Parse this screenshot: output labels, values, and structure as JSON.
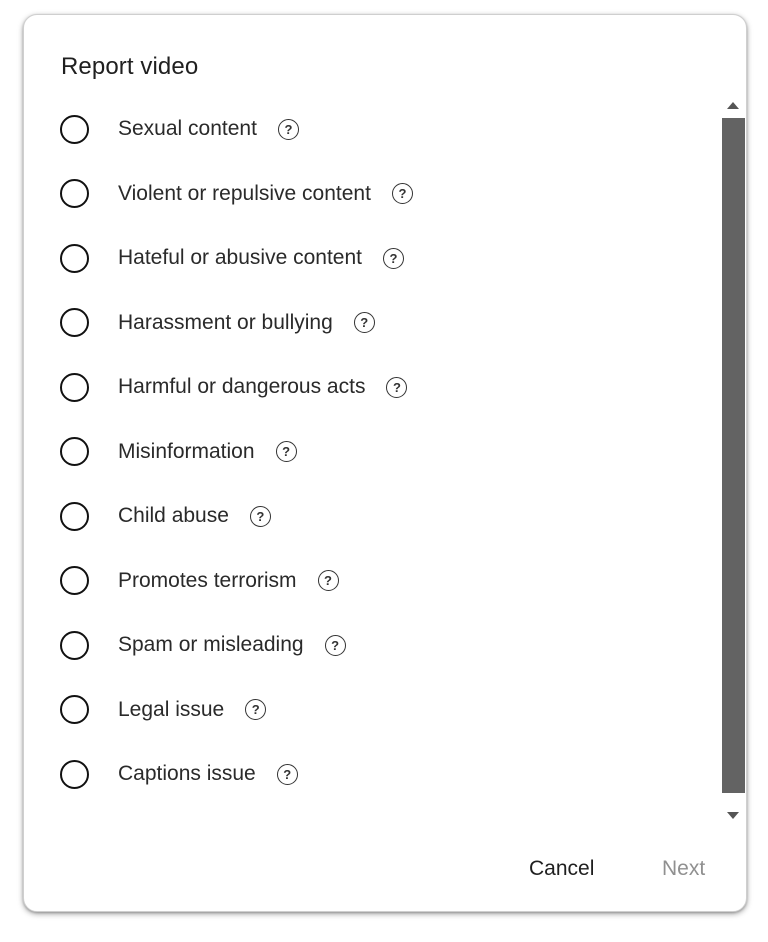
{
  "dialog": {
    "title": "Report video",
    "options": [
      {
        "label": "Sexual content",
        "help_icon": "?"
      },
      {
        "label": "Violent or repulsive content",
        "help_icon": "?"
      },
      {
        "label": "Hateful or abusive content",
        "help_icon": "?"
      },
      {
        "label": "Harassment or bullying",
        "help_icon": "?"
      },
      {
        "label": "Harmful or dangerous acts",
        "help_icon": "?"
      },
      {
        "label": "Misinformation",
        "help_icon": "?"
      },
      {
        "label": "Child abuse",
        "help_icon": "?"
      },
      {
        "label": "Promotes terrorism",
        "help_icon": "?"
      },
      {
        "label": "Spam or misleading",
        "help_icon": "?"
      },
      {
        "label": "Legal issue",
        "help_icon": "?"
      },
      {
        "label": "Captions issue",
        "help_icon": "?"
      }
    ],
    "buttons": {
      "cancel": "Cancel",
      "next": "Next"
    }
  },
  "colors": {
    "text": "#2a2a2a",
    "disabled": "#909090",
    "scrollbar": "#636363"
  }
}
